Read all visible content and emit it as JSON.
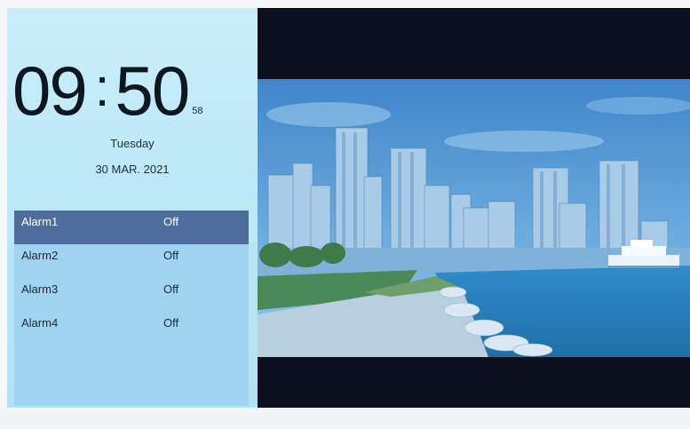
{
  "clock": {
    "hours": "09",
    "separator": ":",
    "minutes": "50",
    "seconds": "58"
  },
  "day": "Tuesday",
  "date": "30 MAR. 2021",
  "alarms": [
    {
      "name": "Alarm1",
      "state": "Off",
      "selected": true
    },
    {
      "name": "Alarm2",
      "state": "Off",
      "selected": false
    },
    {
      "name": "Alarm3",
      "state": "Off",
      "selected": false
    },
    {
      "name": "Alarm4",
      "state": "Off",
      "selected": false
    }
  ],
  "colors": {
    "panel_bg": "#c9eef9",
    "selected_row": "#4d6e9b",
    "alarm_list_bg": "#9fd3ef"
  },
  "photo": {
    "subject": "city-skyline-waterfront"
  }
}
